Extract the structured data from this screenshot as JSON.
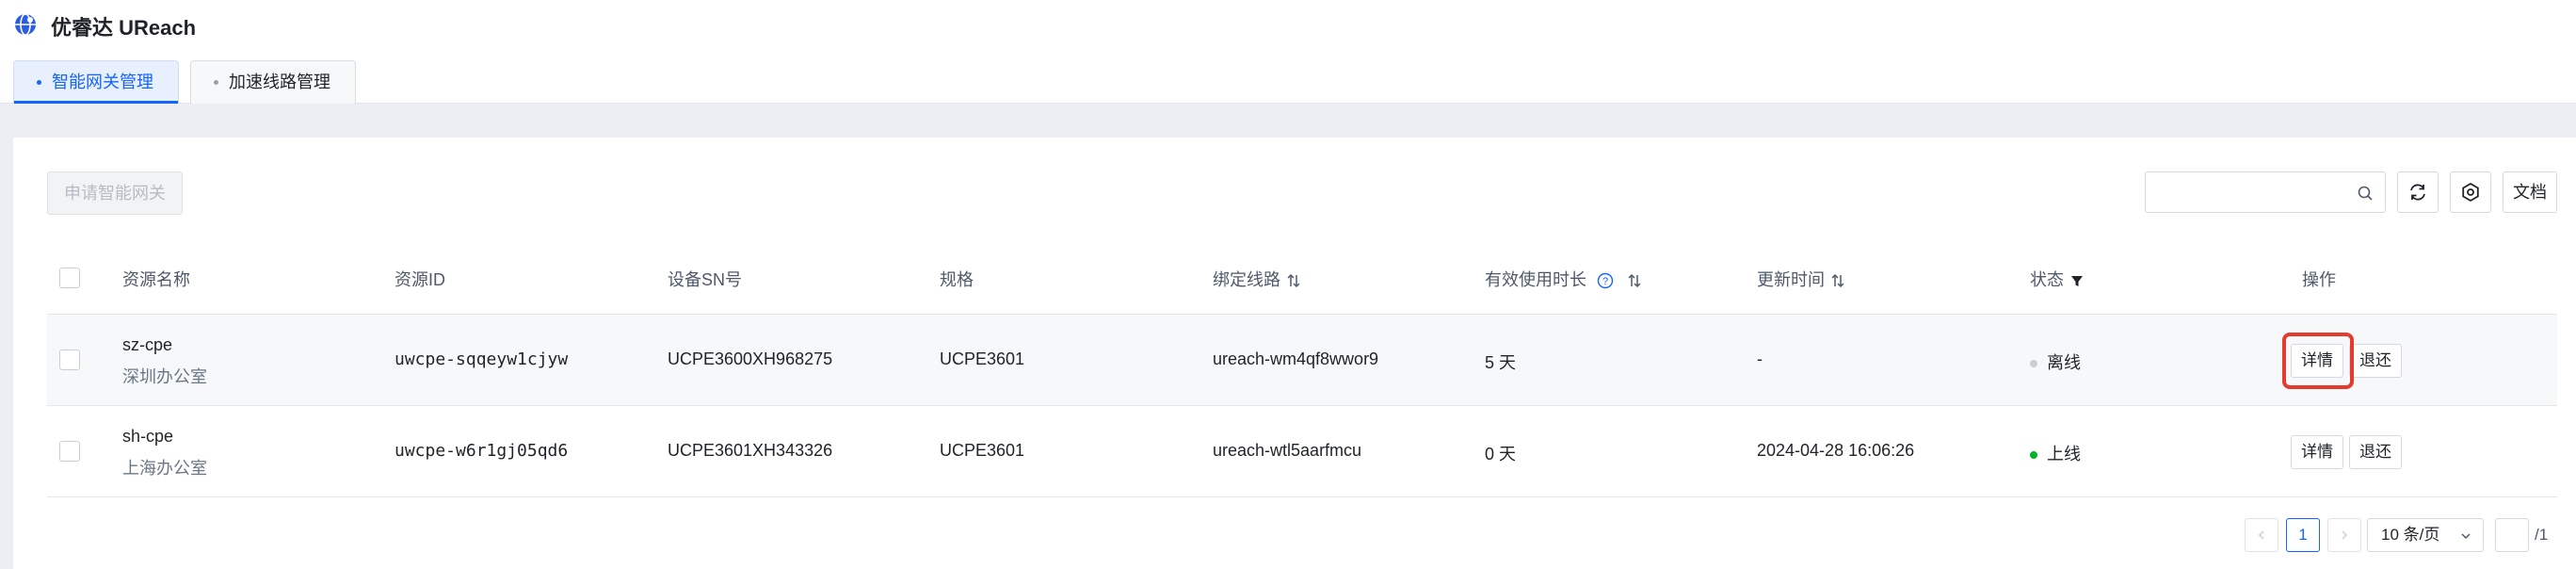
{
  "app": {
    "title": "优睿达 UReach",
    "logo_icon": "globe-icon"
  },
  "tabs": [
    {
      "label": "智能网关管理",
      "active": true
    },
    {
      "label": "加速线路管理",
      "active": false
    }
  ],
  "toolbar": {
    "apply_label": "申请智能网关",
    "search_placeholder": "",
    "refresh_icon": "refresh-icon",
    "settings_icon": "settings-icon",
    "docs_label": "文档"
  },
  "table": {
    "headers": {
      "name": "资源名称",
      "id": "资源ID",
      "sn": "设备SN号",
      "spec": "规格",
      "line": "绑定线路",
      "duration": "有效使用时长",
      "updated": "更新时间",
      "status": "状态",
      "actions": "操作"
    },
    "rows": [
      {
        "name": "sz-cpe",
        "office": "深圳办公室",
        "id": "uwcpe-sqqeyw1cjyw",
        "sn": "UCPE3600XH968275",
        "spec": "UCPE3601",
        "line": "ureach-wm4qf8wwor9",
        "duration": "5 天",
        "updated": "-",
        "status": "离线",
        "status_color": "#c9cdd4",
        "detail_label": "详情",
        "return_label": "退还"
      },
      {
        "name": "sh-cpe",
        "office": "上海办公室",
        "id": "uwcpe-w6r1gj05qd6",
        "sn": "UCPE3601XH343326",
        "spec": "UCPE3601",
        "line": "ureach-wtl5aarfmcu",
        "duration": "0 天",
        "updated": "2024-04-28 16:06:26",
        "status": "上线",
        "status_color": "#00b42a",
        "detail_label": "详情",
        "return_label": "退还"
      }
    ]
  },
  "pagination": {
    "current": "1",
    "page_size": "10 条/页",
    "total_pages": "/1"
  },
  "colors": {
    "accent": "#1664ff",
    "highlight": "#e53b2c"
  }
}
